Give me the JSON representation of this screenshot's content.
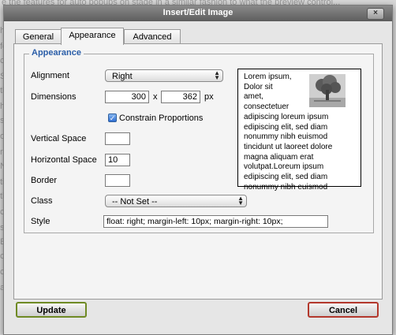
{
  "dialog": {
    "title": "Insert/Edit Image",
    "close_label": "×"
  },
  "tabs": [
    {
      "label": "General"
    },
    {
      "label": "Appearance"
    },
    {
      "label": "Advanced"
    }
  ],
  "appearance": {
    "legend": "Appearance",
    "alignment": {
      "label": "Alignment",
      "value": "Right"
    },
    "dimensions": {
      "label": "Dimensions",
      "width": "300",
      "separator": "x",
      "height": "362",
      "unit": "px"
    },
    "constrain": {
      "label": "Constrain Proportions",
      "checked": true
    },
    "vspace": {
      "label": "Vertical Space",
      "value": ""
    },
    "hspace": {
      "label": "Horizontal Space",
      "value": "10"
    },
    "border": {
      "label": "Border",
      "value": ""
    },
    "class": {
      "label": "Class",
      "value": "-- Not Set --"
    },
    "style": {
      "label": "Style",
      "value": "float: right; margin-left: 10px; margin-right: 10px;"
    },
    "preview_text": "Lorem ipsum,\nDolor sit\namet,\nconsectetuer\nadipiscing loreum ipsum\nedipiscing elit, sed diam\nnonummy nibh euismod\ntincidunt ut laoreet dolore\nmagna aliquam erat\nvolutpat.Loreum ipsum\nedipiscing elit, sed diam\nnonummy nibh euismod"
  },
  "buttons": {
    "update": "Update",
    "cancel": "Cancel"
  },
  "background": {
    "lines": [
      "e the features for auto popups on stage in a similar fashion to what the preview control...",
      "h",
      "fo",
      "cl",
      "S",
      "th",
      "h",
      "s",
      "oj",
      "r",
      "N",
      "ti",
      "th",
      "c",
      "s",
      "E",
      "c",
      "c",
      "ap"
    ]
  },
  "colors": {
    "legend": "#2b5ea8",
    "update_border": "#6f8a24",
    "cancel_border": "#b3382c",
    "titlebar": "#6e6e6e"
  }
}
